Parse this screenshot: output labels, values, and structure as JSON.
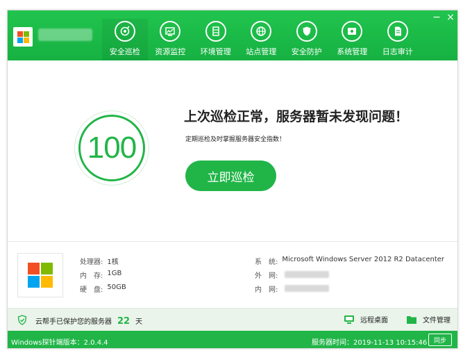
{
  "header": {
    "nav": [
      {
        "label": "安全巡检",
        "icon": "target-icon",
        "active": true
      },
      {
        "label": "资源监控",
        "icon": "monitor-chart-icon",
        "active": false
      },
      {
        "label": "环境管理",
        "icon": "server-stack-icon",
        "active": false
      },
      {
        "label": "站点管理",
        "icon": "globe-icon",
        "active": false
      },
      {
        "label": "安全防护",
        "icon": "shield-icon",
        "active": false
      },
      {
        "label": "系统管理",
        "icon": "system-window-icon",
        "active": false
      },
      {
        "label": "日志审计",
        "icon": "document-icon",
        "active": false
      }
    ],
    "minimize": "−",
    "close": "×"
  },
  "main": {
    "score": "100",
    "title": "上次巡检正常，服务器暂未发现问题！",
    "subtitle": "定期巡检及时掌握服务器安全指数！",
    "scan_button": "立即巡检"
  },
  "info": {
    "cpu_label": "处理器:",
    "cpu_value": "1核",
    "mem_label": "内　存:",
    "mem_value": "1GB",
    "disk_label": "硬　盘:",
    "disk_value": "50GB",
    "os_label": "系　统:",
    "os_value": "Microsoft Windows Server 2012 R2 Datacenter",
    "ext_ip_label": "外　网:",
    "int_ip_label": "内　网:"
  },
  "protect": {
    "prefix": "云帮手已保护您的服务器",
    "days": "22",
    "suffix": "天",
    "remote_desktop": "远程桌面",
    "file_manager": "文件管理"
  },
  "footer": {
    "version": "Windows探针端版本：2.0.4.4",
    "server_time": "服务器时间：2019-11-13 10:15:46",
    "sync": "同步"
  },
  "colors": {
    "brand_green": "#21b548",
    "win_red": "#f25022",
    "win_green": "#7fba00",
    "win_blue": "#00a4ef",
    "win_yellow": "#ffb900"
  }
}
